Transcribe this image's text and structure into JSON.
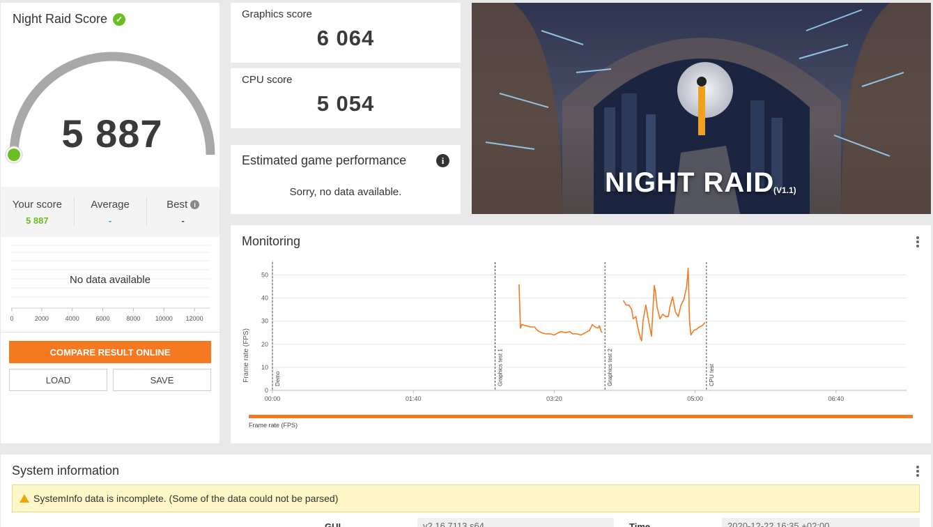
{
  "score": {
    "title": "Night Raid Score",
    "value": "5 887",
    "gauge_fraction": 0.0,
    "your_score_label": "Your score",
    "your_score_value": "5 887",
    "average_label": "Average",
    "average_value": "-",
    "best_label": "Best",
    "best_value": "-",
    "no_data": "No data available",
    "distribution_ticks": [
      "0",
      "2000",
      "4000",
      "6000",
      "8000",
      "10000",
      "12000"
    ],
    "compare_button": "COMPARE RESULT ONLINE",
    "load_button": "LOAD",
    "save_button": "SAVE"
  },
  "graphics": {
    "label": "Graphics score",
    "value": "6 064"
  },
  "cpu": {
    "label": "CPU score",
    "value": "5 054"
  },
  "estimate": {
    "title": "Estimated game performance",
    "message": "Sorry, no data available."
  },
  "banner": {
    "title": "NIGHT RAID",
    "version": "(V1.1)"
  },
  "monitoring": {
    "title": "Monitoring",
    "legend": "Frame rate (FPS)"
  },
  "chart_data": {
    "type": "line",
    "ylabel": "Frame rate (FPS)",
    "xlabel": "",
    "ylim": [
      0,
      55
    ],
    "xlim": [
      0,
      450
    ],
    "yticks": [
      0,
      10,
      20,
      30,
      40,
      50
    ],
    "xticks": [
      {
        "v": 0,
        "label": "00:00"
      },
      {
        "v": 100,
        "label": "01:40"
      },
      {
        "v": 200,
        "label": "03:20"
      },
      {
        "v": 300,
        "label": "05:00"
      },
      {
        "v": 400,
        "label": "06:40"
      }
    ],
    "markers": [
      {
        "t": 0,
        "label": "Demo"
      },
      {
        "t": 158,
        "label": "Graphics test 1"
      },
      {
        "t": 236,
        "label": "Graphics test 2"
      },
      {
        "t": 308,
        "label": "CPU test"
      }
    ],
    "series": [
      {
        "name": "Frame rate (FPS)",
        "color": "#f47920",
        "segments": [
          [
            [
              175,
              46
            ],
            [
              176,
              27
            ],
            [
              177,
              28.5
            ],
            [
              180,
              28
            ],
            [
              183,
              27.5
            ],
            [
              186,
              27.5
            ],
            [
              188,
              26
            ],
            [
              191,
              25
            ],
            [
              194,
              24.5
            ],
            [
              197,
              24.5
            ],
            [
              200,
              24
            ],
            [
              203,
              25
            ],
            [
              205,
              25.5
            ],
            [
              208,
              25
            ],
            [
              211,
              25.5
            ],
            [
              213,
              24.5
            ],
            [
              216,
              24.5
            ],
            [
              219,
              24
            ],
            [
              222,
              25
            ],
            [
              225,
              26
            ],
            [
              227,
              28.5
            ],
            [
              229,
              27.5
            ],
            [
              231,
              27
            ],
            [
              232,
              28
            ],
            [
              233,
              26
            ],
            [
              234,
              25
            ]
          ],
          [
            [
              249,
              39
            ],
            [
              251,
              37
            ],
            [
              253,
              37
            ],
            [
              255,
              35
            ],
            [
              256,
              31
            ],
            [
              258,
              32
            ],
            [
              259,
              28
            ],
            [
              261,
              23
            ],
            [
              262,
              21.5
            ],
            [
              263,
              30
            ],
            [
              265,
              37
            ],
            [
              267,
              30
            ],
            [
              269,
              23.5
            ],
            [
              271,
              45.5
            ],
            [
              272,
              42
            ],
            [
              273,
              36
            ],
            [
              275,
              31
            ],
            [
              277,
              33
            ],
            [
              279,
              32
            ],
            [
              281,
              32
            ],
            [
              282,
              36
            ],
            [
              284,
              40.5
            ],
            [
              286,
              34
            ],
            [
              288,
              32
            ],
            [
              290,
              37
            ],
            [
              292,
              39.5
            ],
            [
              294,
              45
            ],
            [
              295,
              53
            ],
            [
              296,
              30
            ],
            [
              297,
              24
            ],
            [
              299,
              26
            ],
            [
              301,
              26.5
            ],
            [
              303,
              27.5
            ],
            [
              305,
              28
            ],
            [
              307,
              29.5
            ]
          ]
        ]
      }
    ]
  },
  "sysinfo": {
    "title": "System information",
    "warning": "SystemInfo data is incomplete. (Some of the data could not be parsed)",
    "gui_label": "GUI",
    "gui_value": "v2.16.7113 s64",
    "time_label": "Time",
    "time_value": "2020-12-22 16:35 +02:00"
  },
  "colors": {
    "accent": "#f47920",
    "good": "#6bbf24",
    "average": "#2d9be4",
    "gauge": "#a8a8a8"
  }
}
